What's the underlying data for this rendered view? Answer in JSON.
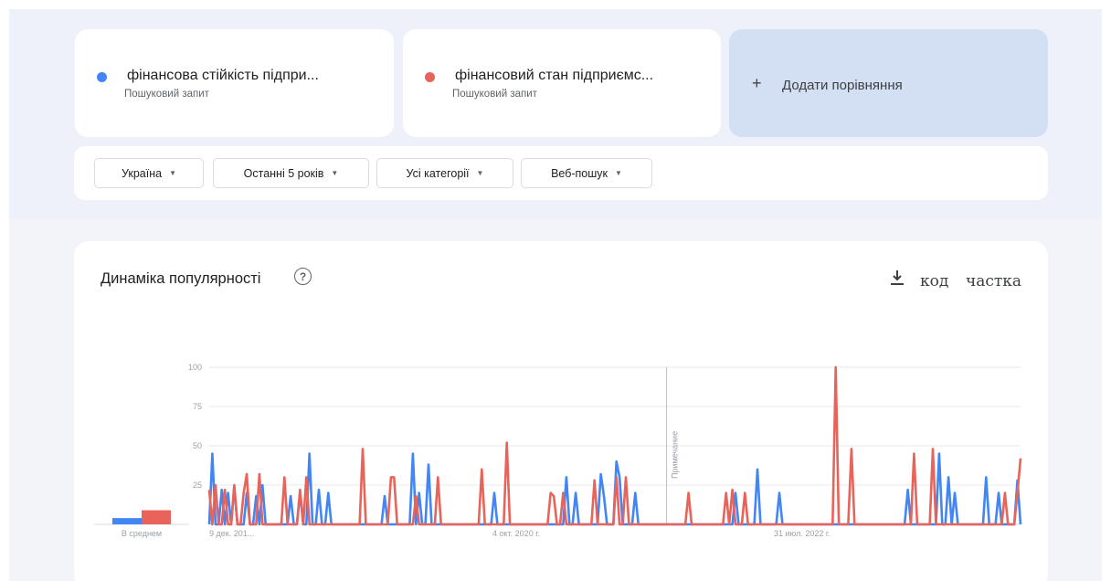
{
  "terms": [
    {
      "name": "фінансова стійкість підпри...",
      "type": "Пошуковий запит",
      "color": "#4285f4"
    },
    {
      "name": "фінансовий стан підприємс...",
      "type": "Пошуковий запит",
      "color": "#e8635a"
    }
  ],
  "add_comparison": {
    "icon": "+",
    "label": "Додати порівняння"
  },
  "filters": [
    {
      "label": "Україна"
    },
    {
      "label": "Останні 5 років"
    },
    {
      "label": "Усі категорії"
    },
    {
      "label": "Веб-пошук"
    }
  ],
  "chart_header": {
    "title": "Динаміка популярності",
    "help_icon": "?",
    "embed_label": "код",
    "share_label": "частка"
  },
  "chart_data": {
    "type": "line",
    "y_ticks": [
      "100",
      "75",
      "50",
      "25"
    ],
    "ylim": [
      0,
      100
    ],
    "x_labels": [
      "9 дек. 201...",
      "4 окт. 2020 г.",
      "31 июл. 2022 г."
    ],
    "annotation_label": "Примечание",
    "annotation_x": 146,
    "average_label": "В среднем",
    "averages": [
      4,
      9
    ],
    "series": [
      {
        "color": "#4285f4",
        "values": [
          0,
          45,
          0,
          0,
          22,
          0,
          20,
          0,
          24,
          0,
          0,
          0,
          20,
          0,
          0,
          18,
          0,
          25,
          0,
          0,
          0,
          0,
          0,
          0,
          0,
          0,
          18,
          0,
          0,
          20,
          0,
          0,
          45,
          0,
          0,
          22,
          0,
          0,
          20,
          0,
          0,
          0,
          0,
          0,
          0,
          0,
          0,
          0,
          0,
          0,
          0,
          0,
          0,
          0,
          0,
          0,
          18,
          0,
          0,
          0,
          0,
          0,
          0,
          0,
          0,
          45,
          0,
          20,
          0,
          0,
          38,
          0,
          0,
          0,
          0,
          0,
          0,
          0,
          0,
          0,
          0,
          0,
          0,
          0,
          0,
          0,
          0,
          0,
          0,
          0,
          0,
          20,
          0,
          0,
          0,
          0,
          0,
          0,
          0,
          0,
          0,
          0,
          0,
          0,
          0,
          0,
          0,
          0,
          0,
          0,
          0,
          0,
          0,
          0,
          30,
          0,
          0,
          20,
          0,
          0,
          0,
          0,
          0,
          0,
          0,
          32,
          18,
          0,
          0,
          0,
          40,
          30,
          0,
          0,
          0,
          0,
          20,
          0,
          0,
          0,
          0,
          0,
          0,
          0,
          0,
          0,
          0,
          0,
          0,
          0,
          0,
          0,
          0,
          0,
          0,
          0,
          0,
          0,
          0,
          0,
          0,
          0,
          0,
          0,
          0,
          0,
          0,
          0,
          20,
          0,
          0,
          0,
          0,
          0,
          0,
          35,
          0,
          0,
          0,
          0,
          0,
          0,
          20,
          0,
          0,
          0,
          0,
          0,
          0,
          0,
          0,
          0,
          0,
          0,
          0,
          0,
          0,
          0,
          0,
          0,
          0,
          0,
          0,
          0,
          0,
          0,
          0,
          0,
          0,
          0,
          0,
          0,
          0,
          0,
          0,
          0,
          0,
          0,
          0,
          0,
          0,
          0,
          0,
          22,
          0,
          0,
          0,
          0,
          0,
          0,
          0,
          0,
          0,
          45,
          0,
          0,
          30,
          0,
          20,
          0,
          0,
          0,
          0,
          0,
          0,
          0,
          0,
          0,
          30,
          0,
          0,
          0,
          20,
          0,
          0,
          0,
          0,
          0,
          28,
          0
        ]
      },
      {
        "color": "#e8635a",
        "values": [
          22,
          0,
          25,
          0,
          0,
          22,
          0,
          0,
          25,
          0,
          0,
          20,
          32,
          0,
          0,
          0,
          32,
          0,
          0,
          0,
          0,
          0,
          0,
          0,
          30,
          0,
          0,
          0,
          0,
          22,
          0,
          30,
          0,
          0,
          0,
          0,
          0,
          0,
          0,
          0,
          0,
          0,
          0,
          0,
          0,
          0,
          0,
          0,
          0,
          48,
          0,
          0,
          0,
          0,
          0,
          0,
          0,
          0,
          30,
          30,
          0,
          0,
          0,
          0,
          0,
          0,
          18,
          0,
          0,
          0,
          0,
          0,
          0,
          30,
          0,
          0,
          0,
          0,
          0,
          0,
          0,
          0,
          0,
          0,
          0,
          0,
          0,
          35,
          0,
          0,
          0,
          0,
          0,
          0,
          0,
          52,
          0,
          0,
          0,
          0,
          0,
          0,
          0,
          0,
          0,
          0,
          0,
          0,
          0,
          20,
          18,
          0,
          0,
          20,
          0,
          0,
          0,
          0,
          0,
          0,
          0,
          0,
          0,
          28,
          0,
          0,
          0,
          0,
          0,
          0,
          30,
          0,
          0,
          30,
          0,
          0,
          0,
          0,
          0,
          0,
          0,
          0,
          0,
          0,
          0,
          0,
          0,
          0,
          0,
          0,
          0,
          0,
          0,
          20,
          0,
          0,
          0,
          0,
          0,
          0,
          0,
          0,
          0,
          0,
          0,
          20,
          0,
          22,
          0,
          0,
          0,
          20,
          0,
          0,
          0,
          0,
          0,
          0,
          0,
          0,
          0,
          0,
          0,
          0,
          0,
          0,
          0,
          0,
          0,
          0,
          0,
          0,
          0,
          0,
          0,
          0,
          0,
          0,
          0,
          0,
          100,
          0,
          0,
          0,
          0,
          48,
          0,
          0,
          0,
          0,
          0,
          0,
          0,
          0,
          0,
          0,
          0,
          0,
          0,
          0,
          0,
          0,
          0,
          0,
          0,
          45,
          0,
          0,
          0,
          0,
          0,
          48,
          0,
          0,
          0,
          0,
          0,
          0,
          0,
          0,
          0,
          0,
          0,
          0,
          0,
          0,
          0,
          0,
          0,
          0,
          0,
          0,
          0,
          0,
          20,
          0,
          0,
          0,
          20,
          42
        ]
      }
    ]
  }
}
